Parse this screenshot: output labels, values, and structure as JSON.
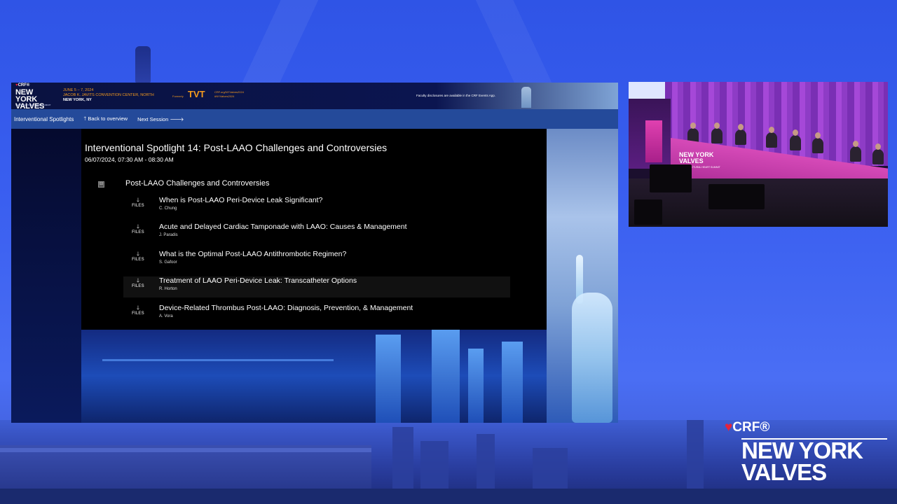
{
  "header": {
    "crf_logo": "CRF®",
    "logo_title": "NEW YORK VALVES",
    "logo_subtitle": "THE STRUCTURAL HEART SUMMIT",
    "event_dates": "JUNE 5 – 7, 2024",
    "event_venue": "JACOB K. JAVITS CONVENTION CENTER, NORTH",
    "event_city": "NEW YORK, NY",
    "tvt_formerly": "Formerly",
    "tvt_logo": "TVT",
    "tvt_link_1": "CRF.org/NYValves2024",
    "tvt_link_2": "#NYValves2024",
    "faculty_note": "Faculty disclosures are available in the CRF Events App."
  },
  "nav": {
    "current": "Interventional Spotlights",
    "back": "🡑 Back to overview",
    "next": "Next Session 🡒"
  },
  "session": {
    "title": "Interventional Spotlight 14: Post-LAAO Challenges and Controversies",
    "time": "06/07/2024, 07:30 AM - 08:30 AM",
    "toggle_icon": "⊟",
    "section_title": "Post-LAAO Challenges and Controversies",
    "files_label": "FILES",
    "download_icon": "🡓",
    "talks": [
      {
        "title": "When is Post-LAAO Peri-Device Leak Significant?",
        "speaker": "C. Chung"
      },
      {
        "title": "Acute and Delayed Cardiac Tamponade with LAAO: Causes & Management",
        "speaker": "J. Paradis"
      },
      {
        "title": "What is the Optimal Post-LAAO Antithrombotic Regimen?",
        "speaker": "S. Gafoor"
      },
      {
        "title": "Treatment of LAAO Peri-Device Leak: Transcatheter Options",
        "speaker": "R. Horton"
      },
      {
        "title": "Device-Related Thrombus Post-LAAO: Diagnosis, Prevention, & Management",
        "speaker": "A. Vora"
      }
    ]
  },
  "video": {
    "table_logo": "NEW YORK VALVES",
    "table_subtitle": "THE STRUCTURAL HEART SUMMIT"
  },
  "brand": {
    "crf": "CRF®",
    "line1": "NEW YORK",
    "line2": "VALVES"
  },
  "colors": {
    "background": "#3a5ff0",
    "navbar": "#244a9a",
    "panel": "#000000",
    "accent_orange": "#f39a1e",
    "crf_red": "#e5233d",
    "stage_magenta": "#d64ab8"
  }
}
